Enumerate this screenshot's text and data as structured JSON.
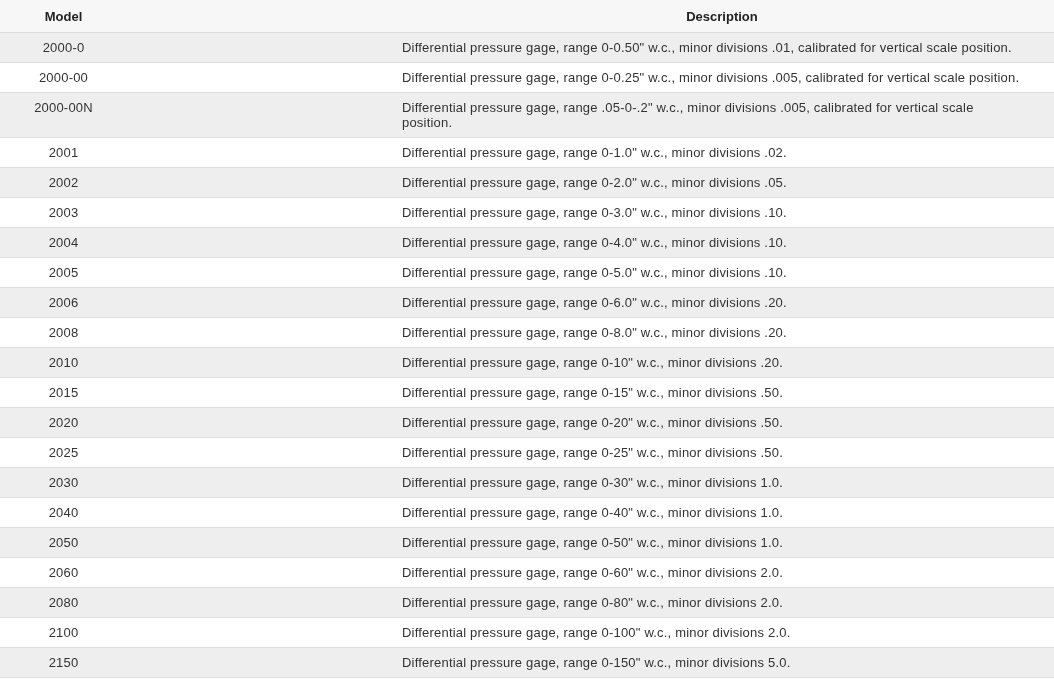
{
  "table": {
    "columns": [
      "Model",
      "Description"
    ],
    "rows": [
      {
        "model": "2000-0",
        "description": "Differential pressure gage, range 0-0.50\" w.c., minor divisions .01, calibrated for vertical scale position."
      },
      {
        "model": "2000-00",
        "description": "Differential pressure gage, range 0-0.25\" w.c., minor divisions .005, calibrated for vertical scale position."
      },
      {
        "model": "2000-00N",
        "description": "Differential pressure gage, range .05-0-.2\" w.c., minor divisions .005, calibrated for vertical scale position."
      },
      {
        "model": "2001",
        "description": "Differential pressure gage, range 0-1.0\" w.c., minor divisions .02."
      },
      {
        "model": "2002",
        "description": "Differential pressure gage, range 0-2.0\" w.c., minor divisions .05."
      },
      {
        "model": "2003",
        "description": "Differential pressure gage, range 0-3.0\" w.c., minor divisions .10."
      },
      {
        "model": "2004",
        "description": "Differential pressure gage, range 0-4.0\" w.c., minor divisions .10."
      },
      {
        "model": "2005",
        "description": "Differential pressure gage, range 0-5.0\" w.c., minor divisions .10."
      },
      {
        "model": "2006",
        "description": "Differential pressure gage, range 0-6.0\" w.c., minor divisions .20."
      },
      {
        "model": "2008",
        "description": "Differential pressure gage, range 0-8.0\" w.c., minor divisions .20."
      },
      {
        "model": "2010",
        "description": "Differential pressure gage, range 0-10\" w.c., minor divisions .20."
      },
      {
        "model": "2015",
        "description": "Differential pressure gage, range 0-15\" w.c., minor divisions .50."
      },
      {
        "model": "2020",
        "description": "Differential pressure gage, range 0-20\" w.c., minor divisions .50."
      },
      {
        "model": "2025",
        "description": "Differential pressure gage, range 0-25\" w.c., minor divisions .50."
      },
      {
        "model": "2030",
        "description": "Differential pressure gage, range 0-30\" w.c., minor divisions 1.0."
      },
      {
        "model": "2040",
        "description": "Differential pressure gage, range 0-40\" w.c., minor divisions 1.0."
      },
      {
        "model": "2050",
        "description": "Differential pressure gage, range 0-50\" w.c., minor divisions 1.0."
      },
      {
        "model": "2060",
        "description": "Differential pressure gage, range 0-60\" w.c., minor divisions 2.0."
      },
      {
        "model": "2080",
        "description": "Differential pressure gage, range 0-80\" w.c., minor divisions 2.0."
      },
      {
        "model": "2100",
        "description": "Differential pressure gage, range 0-100\" w.c., minor divisions 2.0."
      },
      {
        "model": "2150",
        "description": "Differential pressure gage, range 0-150\" w.c., minor divisions 5.0."
      }
    ]
  }
}
